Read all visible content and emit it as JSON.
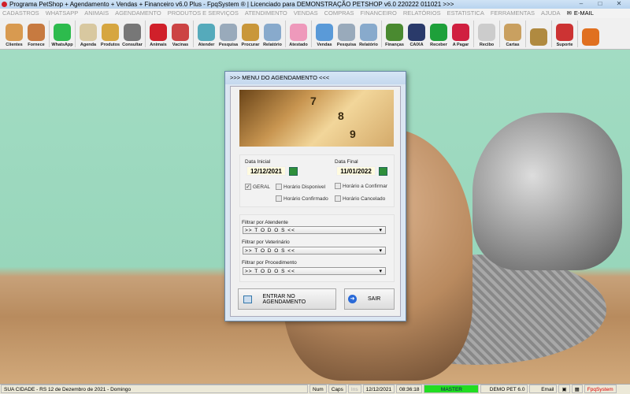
{
  "window": {
    "title": "Programa PetShop + Agendamento + Vendas + Financeiro v6.0 Plus - FpqSystem ® | Licenciado para  DEMONSTRAÇÃO PETSHOP v6.0 220222 011021 >>>",
    "minimize": "–",
    "maximize": "□",
    "close": "✕"
  },
  "menu": [
    "CADASTROS",
    "WHATSAPP",
    "ANIMAIS",
    "AGENDAMENTO",
    "PRODUTOS E SERVIÇOS",
    "ATENDIMENTO",
    "VENDAS",
    "COMPRAS",
    "FINANCEIRO",
    "RELATÓRIOS",
    "ESTATISTICA",
    "FERRAMENTAS",
    "AJUDA"
  ],
  "menu_email": "E-MAIL",
  "toolbar": [
    {
      "label": "Clientes",
      "color": "#d89a50"
    },
    {
      "label": "Fornece",
      "color": "#c77a40"
    },
    {
      "sep": true
    },
    {
      "label": "WhatsApp",
      "color": "#2dbb4d"
    },
    {
      "sep": true
    },
    {
      "label": "Agenda",
      "color": "#d8c8a0"
    },
    {
      "label": "Produtos",
      "color": "#d6a640"
    },
    {
      "label": "Consultar",
      "color": "#777"
    },
    {
      "sep": true
    },
    {
      "label": "Animais",
      "color": "#d0202a"
    },
    {
      "label": "Vacinas",
      "color": "#c44"
    },
    {
      "sep": true
    },
    {
      "label": "Atender",
      "color": "#5ab"
    },
    {
      "label": "Pesquisa",
      "color": "#9ab"
    },
    {
      "label": "Procurar",
      "color": "#c9973a"
    },
    {
      "label": "Relatório",
      "color": "#8ac"
    },
    {
      "sep": true
    },
    {
      "label": "Atestado",
      "color": "#e9b"
    },
    {
      "sep": true
    },
    {
      "label": "Vendas",
      "color": "#5a9ad8"
    },
    {
      "label": "Pesquisa",
      "color": "#9ab"
    },
    {
      "label": "Relatório",
      "color": "#8ac"
    },
    {
      "sep": true
    },
    {
      "label": "Finanças",
      "color": "#4a8a30"
    },
    {
      "label": "CAIXA",
      "color": "#2a3a6a"
    },
    {
      "label": "Receber",
      "color": "#1ea03a"
    },
    {
      "label": "A Pagar",
      "color": "#d02040"
    },
    {
      "sep": true
    },
    {
      "label": "Recibo",
      "color": "#ccc"
    },
    {
      "sep": true
    },
    {
      "label": "Cartas",
      "color": "#c9a060"
    },
    {
      "sep": true
    },
    {
      "label": "",
      "color": "#b08a40"
    },
    {
      "sep": true
    },
    {
      "label": "Suporte",
      "color": "#c33"
    },
    {
      "sep": true
    },
    {
      "label": "",
      "color": "#e07020"
    }
  ],
  "dialog": {
    "title": ">>>  MENU DO AGENDAMENTO  <<<",
    "banner_numbers": [
      "7",
      "8",
      "9"
    ],
    "data_inicial_label": "Data Inicial",
    "data_inicial": "12/12/2021",
    "data_final_label": "Data Final",
    "data_final": "11/01/2022",
    "checks": {
      "geral": "GERAL",
      "disponivel": "Horário  Disponivel",
      "confirmado": "Horário Confirmado",
      "a_confirmar": "Horário a Confirmar",
      "cancelado": "Horário Cancelado"
    },
    "filters": [
      {
        "label": "Filtrar por Atendente",
        "value": ">> T O D O S <<"
      },
      {
        "label": "Filtrar por Veterinário",
        "value": ">> T O D O S <<"
      },
      {
        "label": "Filtrar por Procedimento",
        "value": ">> T O D O S <<"
      }
    ],
    "enter_button": "ENTRAR NO AGENDAMENTO",
    "exit_button": "SAIR"
  },
  "status": {
    "location": "SUA CIDADE - RS 12 de Dezembro de 2021 - Domingo",
    "num": "Num",
    "caps": "Caps",
    "ins": "Ins",
    "date": "12/12/2021",
    "time": "08:36:18",
    "user": "MASTER",
    "company": "DEMO PET 6.0",
    "email": "Email",
    "brand": "FpqSystem"
  }
}
